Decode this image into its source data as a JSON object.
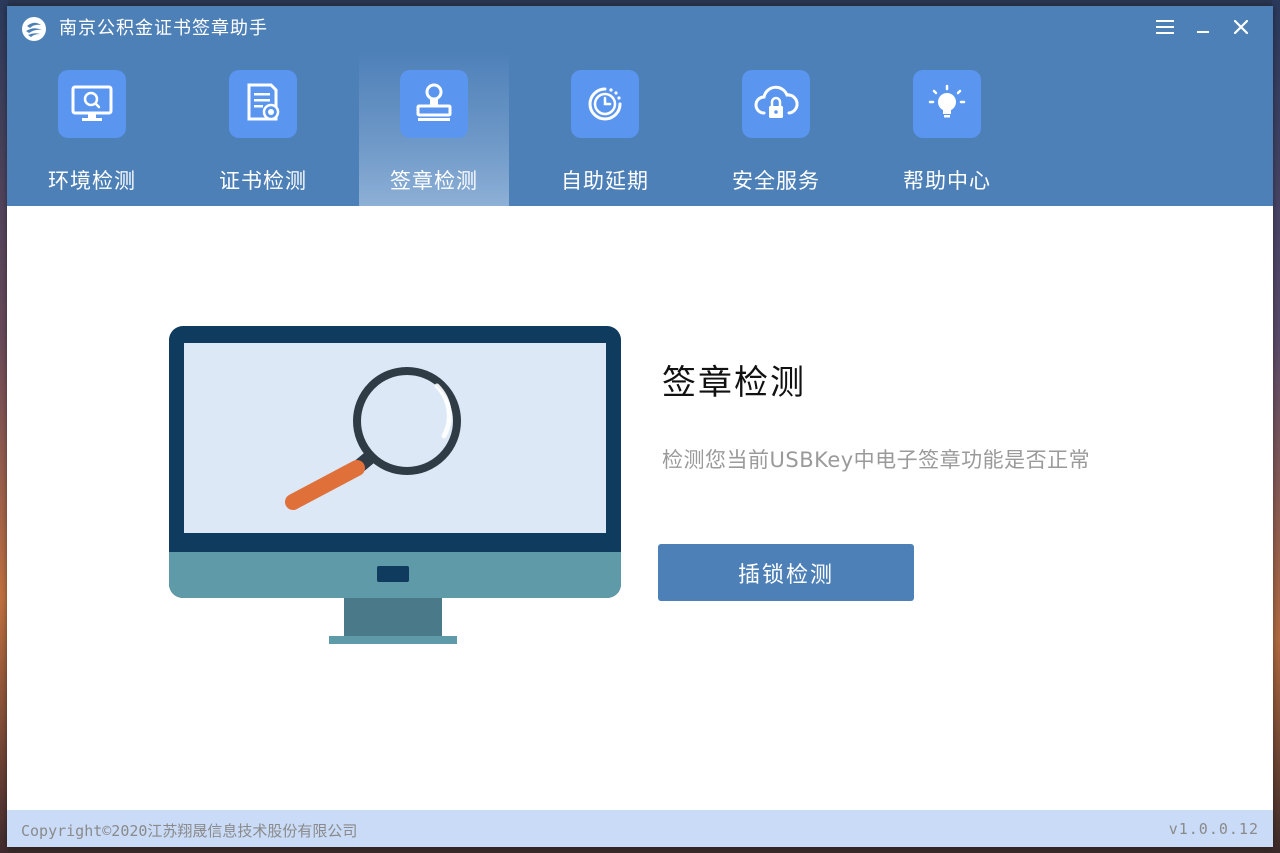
{
  "window": {
    "title": "南京公积金证书签章助手",
    "controls": [
      "menu-icon",
      "minimize-icon",
      "close-icon"
    ]
  },
  "nav": {
    "items": [
      {
        "label": "环境检测",
        "icon": "monitor-search-icon",
        "active": false
      },
      {
        "label": "证书检测",
        "icon": "certificate-icon",
        "active": false
      },
      {
        "label": "签章检测",
        "icon": "stamp-icon",
        "active": true
      },
      {
        "label": "自助延期",
        "icon": "clock-renew-icon",
        "active": false
      },
      {
        "label": "安全服务",
        "icon": "cloud-lock-icon",
        "active": false
      },
      {
        "label": "帮助中心",
        "icon": "lightbulb-icon",
        "active": false
      }
    ]
  },
  "main": {
    "title": "签章检测",
    "description": "检测您当前USBKey中电子签章功能是否正常",
    "button_label": "插锁检测"
  },
  "footer": {
    "copyright": "Copyright©2020江苏翔晟信息技术股份有限公司",
    "version": "v1.0.0.12"
  },
  "colors": {
    "header": "#4e80b8",
    "icon_tile": "#5a95f0",
    "footer": "#c9dbf7",
    "button": "#4e80b8"
  }
}
